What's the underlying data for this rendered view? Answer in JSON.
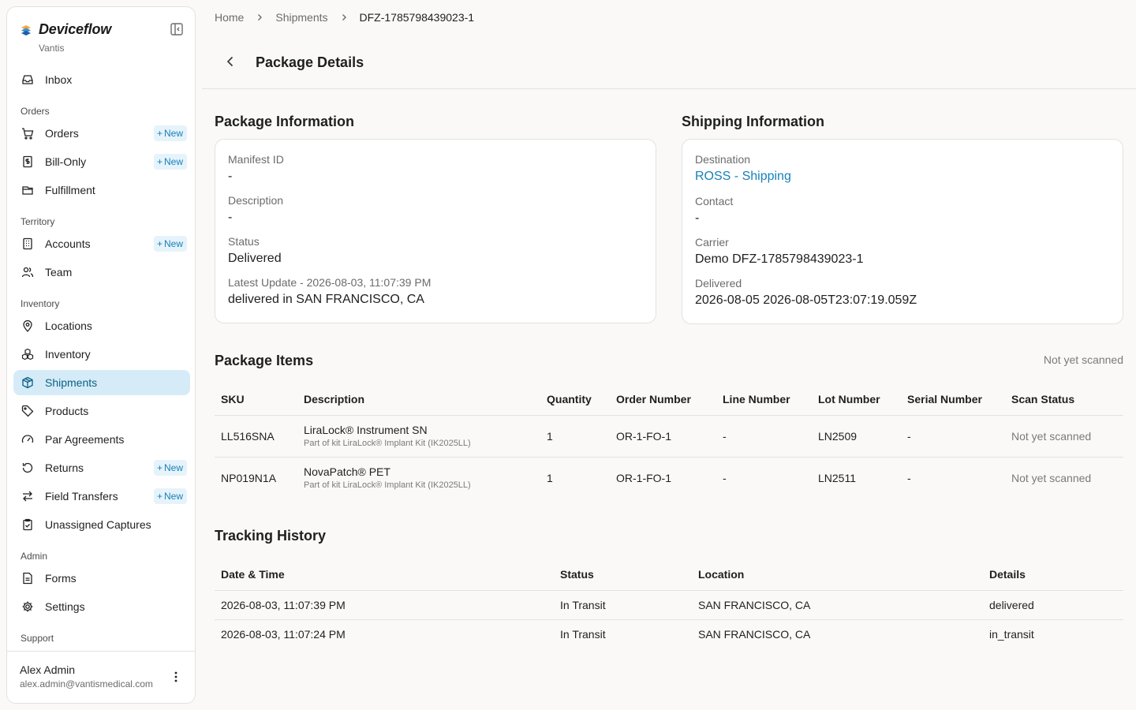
{
  "sidebar": {
    "brand": "Deviceflow",
    "org": "Vantis",
    "new_label": "New",
    "items": {
      "inbox": "Inbox",
      "orders_section": "Orders",
      "orders": "Orders",
      "bill_only": "Bill-Only",
      "fulfillment": "Fulfillment",
      "territory_section": "Territory",
      "accounts": "Accounts",
      "team": "Team",
      "inventory_section": "Inventory",
      "locations": "Locations",
      "inventory": "Inventory",
      "shipments": "Shipments",
      "products": "Products",
      "par_agreements": "Par Agreements",
      "returns": "Returns",
      "field_transfers": "Field Transfers",
      "unassigned_captures": "Unassigned Captures",
      "admin_section": "Admin",
      "forms": "Forms",
      "settings": "Settings",
      "support_section": "Support"
    },
    "user": {
      "name": "Alex Admin",
      "email": "alex.admin@vantismedical.com"
    }
  },
  "breadcrumb": {
    "home": "Home",
    "shipments": "Shipments",
    "current": "DFZ-1785798439023-1"
  },
  "page_title": "Package Details",
  "package_info": {
    "title": "Package Information",
    "manifest_label": "Manifest ID",
    "manifest_value": "-",
    "description_label": "Description",
    "description_value": "-",
    "status_label": "Status",
    "status_value": "Delivered",
    "latest_label": "Latest Update - 2026-08-03, 11:07:39 PM",
    "latest_value": "delivered in SAN FRANCISCO, CA"
  },
  "shipping_info": {
    "title": "Shipping Information",
    "destination_label": "Destination",
    "destination_value": "ROSS - Shipping",
    "contact_label": "Contact",
    "contact_value": "-",
    "carrier_label": "Carrier",
    "carrier_value": "Demo DFZ-1785798439023-1",
    "delivered_label": "Delivered",
    "delivered_value": "2026-08-05 2026-08-05T23:07:19.059Z"
  },
  "package_items": {
    "title": "Package Items",
    "scan_summary": "Not yet scanned",
    "headers": [
      "SKU",
      "Description",
      "Quantity",
      "Order Number",
      "Line Number",
      "Lot Number",
      "Serial Number",
      "Scan Status"
    ],
    "rows": [
      {
        "sku": "LL516SNA",
        "desc": "LiraLock® Instrument SN",
        "kit": "Part of kit LiraLock® Implant Kit (IK2025LL)",
        "qty": "1",
        "order": "OR-1-FO-1",
        "line": "-",
        "lot": "LN2509",
        "serial": "-",
        "scan": "Not yet scanned"
      },
      {
        "sku": "NP019N1A",
        "desc": "NovaPatch® PET",
        "kit": "Part of kit LiraLock® Implant Kit (IK2025LL)",
        "qty": "1",
        "order": "OR-1-FO-1",
        "line": "-",
        "lot": "LN2511",
        "serial": "-",
        "scan": "Not yet scanned"
      }
    ]
  },
  "tracking": {
    "title": "Tracking History",
    "headers": [
      "Date & Time",
      "Status",
      "Location",
      "Details"
    ],
    "rows": [
      {
        "datetime": "2026-08-03, 11:07:39 PM",
        "status": "In Transit",
        "location": "SAN FRANCISCO, CA",
        "details": "delivered"
      },
      {
        "datetime": "2026-08-03, 11:07:24 PM",
        "status": "In Transit",
        "location": "SAN FRANCISCO, CA",
        "details": "in_transit"
      }
    ]
  },
  "colors": {
    "accent": "#1781b9",
    "active_bg": "#d5ecf8",
    "background": "#faf9f7"
  }
}
